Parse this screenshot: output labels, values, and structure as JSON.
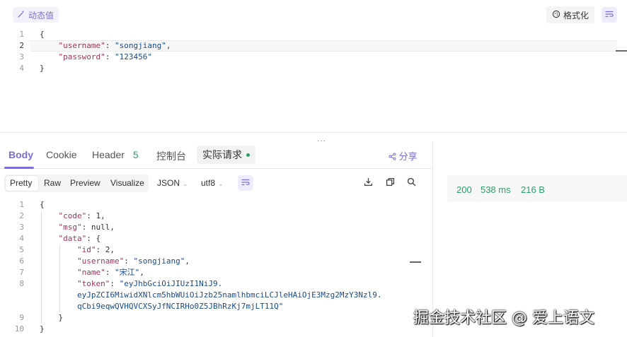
{
  "request": {
    "dynamic_value_label": "动态值",
    "format_label": "格式化",
    "body_lines": [
      {
        "num": "1",
        "parts": [
          {
            "t": "{",
            "c": "p"
          }
        ]
      },
      {
        "num": "2",
        "parts": [
          {
            "t": "    ",
            "c": "p"
          },
          {
            "t": "\"username\"",
            "c": "k"
          },
          {
            "t": ": ",
            "c": "p"
          },
          {
            "t": "\"songjiang\"",
            "c": "s"
          },
          {
            "t": ",",
            "c": "p"
          }
        ]
      },
      {
        "num": "3",
        "parts": [
          {
            "t": "    ",
            "c": "p"
          },
          {
            "t": "\"password\"",
            "c": "k"
          },
          {
            "t": ": ",
            "c": "p"
          },
          {
            "t": "\"123456\"",
            "c": "s"
          }
        ]
      },
      {
        "num": "4",
        "parts": [
          {
            "t": "}",
            "c": "p"
          }
        ]
      }
    ]
  },
  "splitter_glyph": "···",
  "response": {
    "tabs": {
      "body": "Body",
      "cookie": "Cookie",
      "header": "Header",
      "header_count": "5",
      "console": "控制台",
      "actual_request": "实际请求"
    },
    "share_label": "分享",
    "view_modes": [
      "Pretty",
      "Raw",
      "Preview",
      "Visualize"
    ],
    "format_select": "JSON",
    "encoding_select": "utf8",
    "body_lines": [
      {
        "num": "1",
        "parts": [
          {
            "t": "{",
            "c": "p"
          }
        ]
      },
      {
        "num": "2",
        "parts": [
          {
            "t": "    ",
            "c": "p"
          },
          {
            "t": "\"code\"",
            "c": "k"
          },
          {
            "t": ": ",
            "c": "p"
          },
          {
            "t": "1",
            "c": "n"
          },
          {
            "t": ",",
            "c": "p"
          }
        ]
      },
      {
        "num": "3",
        "parts": [
          {
            "t": "    ",
            "c": "p"
          },
          {
            "t": "\"msg\"",
            "c": "k"
          },
          {
            "t": ": ",
            "c": "p"
          },
          {
            "t": "null",
            "c": "n"
          },
          {
            "t": ",",
            "c": "p"
          }
        ]
      },
      {
        "num": "4",
        "parts": [
          {
            "t": "    ",
            "c": "p"
          },
          {
            "t": "\"data\"",
            "c": "k"
          },
          {
            "t": ": {",
            "c": "p"
          }
        ]
      },
      {
        "num": "5",
        "parts": [
          {
            "t": "        ",
            "c": "p"
          },
          {
            "t": "\"id\"",
            "c": "k"
          },
          {
            "t": ": ",
            "c": "p"
          },
          {
            "t": "2",
            "c": "n"
          },
          {
            "t": ",",
            "c": "p"
          }
        ]
      },
      {
        "num": "6",
        "parts": [
          {
            "t": "        ",
            "c": "p"
          },
          {
            "t": "\"username\"",
            "c": "k"
          },
          {
            "t": ": ",
            "c": "p"
          },
          {
            "t": "\"songjiang\"",
            "c": "s"
          },
          {
            "t": ",",
            "c": "p"
          }
        ]
      },
      {
        "num": "7",
        "parts": [
          {
            "t": "        ",
            "c": "p"
          },
          {
            "t": "\"name\"",
            "c": "k"
          },
          {
            "t": ": ",
            "c": "p"
          },
          {
            "t": "\"宋江\"",
            "c": "s"
          },
          {
            "t": ",",
            "c": "p"
          }
        ]
      },
      {
        "num": "8",
        "parts": [
          {
            "t": "        ",
            "c": "p"
          },
          {
            "t": "\"token\"",
            "c": "k"
          },
          {
            "t": ": ",
            "c": "p"
          },
          {
            "t": "\"eyJhbGciOiJIUzI1NiJ9.",
            "c": "s"
          }
        ]
      },
      {
        "num": "",
        "parts": [
          {
            "t": "        eyJpZCI6MiwidXNlcm5hbWUiOiJzb25namlhbmciLCJleHAiOjE3Mzg2MzY3Nzl9.",
            "c": "s"
          }
        ]
      },
      {
        "num": "",
        "parts": [
          {
            "t": "        qCbi9eqwQVHQVCXSyJfNCIRHo0Z5JBhRzKj7mjLT11Q\"",
            "c": "s"
          }
        ]
      },
      {
        "num": "9",
        "parts": [
          {
            "t": "    }",
            "c": "p"
          }
        ]
      },
      {
        "num": "10",
        "parts": [
          {
            "t": "}",
            "c": "p"
          }
        ]
      }
    ],
    "status": {
      "code": "200",
      "time": "538 ms",
      "size": "216 B"
    }
  },
  "watermark": "掘金技术社区 @ 爱上语文",
  "colors": {
    "accent": "#7a6fd6",
    "success": "#2e9e6a",
    "key": "#a0375a",
    "string": "#1a4a8a"
  },
  "icons": {
    "dynamic_value": "magic-wand-icon",
    "format": "format-icon",
    "wrap": "wrap-lines-icon",
    "share": "share-icon",
    "download": "download-icon",
    "copy": "copy-icon",
    "search": "search-icon"
  }
}
